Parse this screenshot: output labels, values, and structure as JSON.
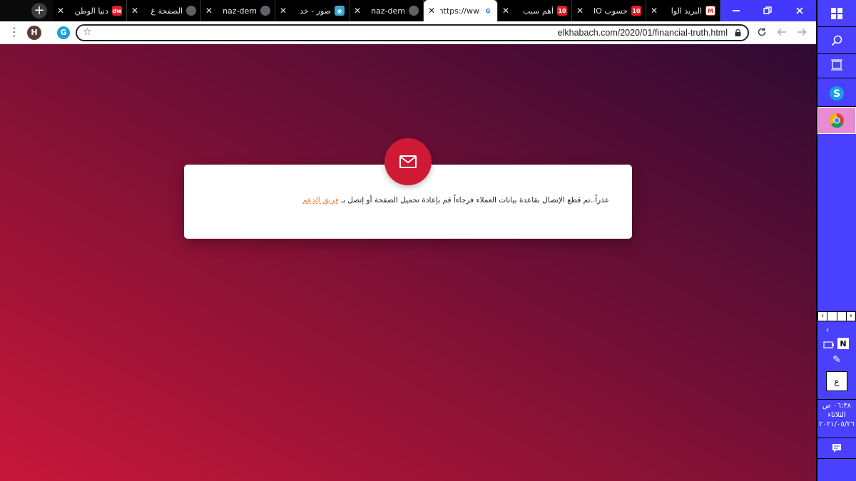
{
  "tabs": [
    {
      "title": "دنيا الوطن",
      "favicon": "red-news-icon",
      "fav_text": "dw"
    },
    {
      "title": "الصفحة غ",
      "favicon": "globe-icon",
      "fav_text": ""
    },
    {
      "title": "naz-dem",
      "favicon": "globe-icon",
      "fav_text": ""
    },
    {
      "title": "صور - خد",
      "favicon": "camera-icon",
      "fav_text": "◉"
    },
    {
      "title": "naz-dem",
      "favicon": "globe-icon",
      "fav_text": ""
    },
    {
      "title": "https://ww",
      "favicon": "google-icon",
      "fav_text": "G",
      "active": true
    },
    {
      "title": "أهم سبب",
      "favicon": "red-news-icon",
      "fav_text": "10"
    },
    {
      "title": "حسوب IO",
      "favicon": "red-news-icon",
      "fav_text": "10"
    },
    {
      "title": "البريد الوا",
      "favicon": "gmail-icon",
      "fav_text": "M"
    }
  ],
  "toolbar": {
    "avatar_letter": "H",
    "url": "elkhabach.com/2020/01/financial-truth.html"
  },
  "page": {
    "message": "عذراً..تم قطع الإتصال بقاعدة بيانات العملاء فرجاءاً قم بإعادة تحميل الصفحة أو إتصل بـ",
    "support_link": "فريق الدعم"
  },
  "taskbar": {
    "lang": "ع",
    "time": "٠٦:٣٨ ص",
    "day": "الثلاثاء",
    "date": "٢٠٢١/٠٥/٢٦"
  },
  "colors": {
    "accent": "#cf1a35",
    "taskbar": "#4a40ff",
    "link": "#e57a2a"
  }
}
